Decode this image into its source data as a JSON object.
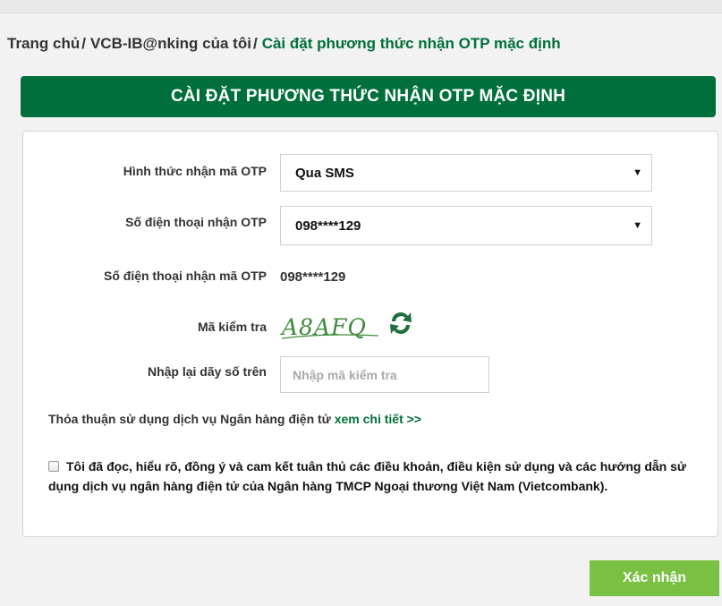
{
  "breadcrumb": {
    "home": "Trang chủ",
    "my_banking": "VCB-IB@nking của tôi",
    "current": "Cài đặt phương thức nhận OTP mặc định",
    "separator": "/"
  },
  "page_title": "CÀI ĐẶT PHƯƠNG THỨC NHẬN OTP MẶC ĐỊNH",
  "form": {
    "otp_method": {
      "label": "Hình thức nhận mã OTP",
      "selected": "Qua SMS"
    },
    "otp_phone": {
      "label": "Số điện thoại nhận OTP",
      "selected": "098****129"
    },
    "otp_phone_display": {
      "label": "Số điện thoại nhận mã OTP",
      "value": "098****129"
    },
    "captcha": {
      "label": "Mã kiểm tra",
      "code": "A8AFQ"
    },
    "captcha_input": {
      "label": "Nhập lại dãy số trên",
      "placeholder": "Nhập mã kiểm tra"
    }
  },
  "agreement": {
    "text": "Thỏa thuận sử dụng dịch vụ Ngân hàng điện tử ",
    "link": "xem chi tiết >>"
  },
  "terms_text": "Tôi đã đọc, hiểu rõ, đồng ý và cam kết tuân thủ các điều khoản, điều kiện sử dụng và các hướng dẫn sử dụng dịch vụ ngân hàng điện tử của Ngân hàng TMCP Ngoại thương Việt Nam (Vietcombank).",
  "confirm_label": "Xác nhận",
  "colors": {
    "brand_green": "#006f3c",
    "button_green": "#7ac043"
  }
}
